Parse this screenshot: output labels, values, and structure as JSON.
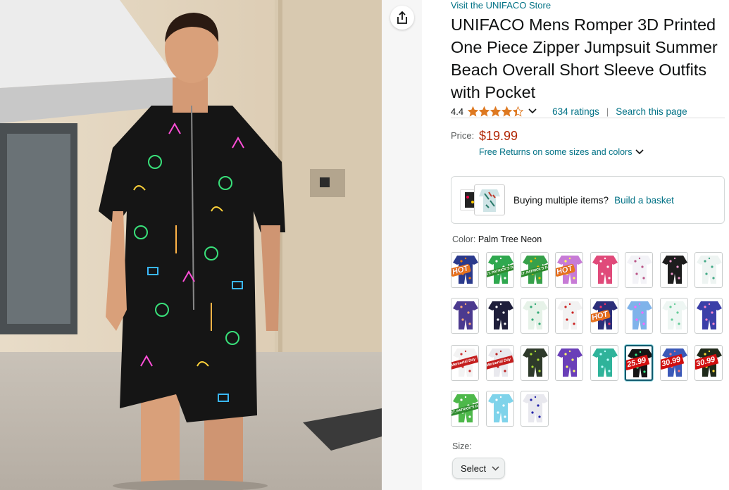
{
  "store_link": "Visit the UNIFACO Store",
  "title": "UNIFACO Mens Romper 3D Printed One Piece Zipper Jumpsuit Summer Beach Overall Short Sleeve Outfits with Pocket",
  "rating": {
    "value": "4.4",
    "stars": 4.4,
    "count_text": "634 ratings",
    "separator": "|",
    "search_link": "Search this page"
  },
  "price": {
    "label": "Price:",
    "value": "$19.99",
    "returns": "Free Returns on some sizes and colors"
  },
  "basket": {
    "text": "Buying multiple items?",
    "link": "Build a basket"
  },
  "color": {
    "label": "Color:",
    "selected": "Palm Tree Neon"
  },
  "swatch_tags": {
    "hot": "HOT",
    "patrick": "ST. PATRICK'S DAY",
    "memorial": "Memorial Day",
    "price_2599": "25.99",
    "price_3099": "30.99"
  },
  "size": {
    "label": "Size:",
    "value": "Select"
  },
  "colors": {
    "link": "#007185",
    "price": "#b12704",
    "star": "#de7921",
    "selected_border": "#0f5a6e"
  }
}
